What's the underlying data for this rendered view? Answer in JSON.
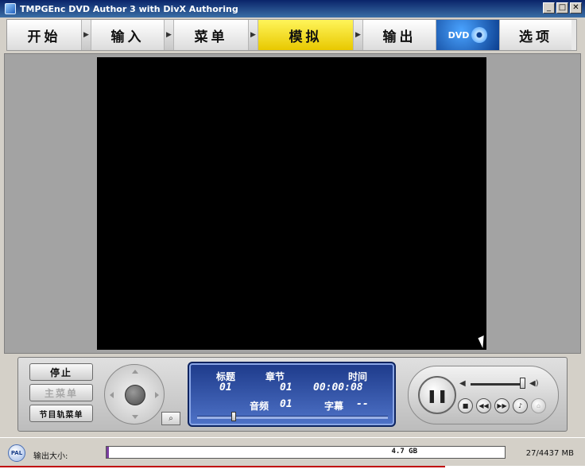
{
  "window": {
    "title": "TMPGEnc DVD Author 3 with DivX Authoring"
  },
  "tabs": [
    {
      "label": "开始"
    },
    {
      "label": "输入"
    },
    {
      "label": "菜单"
    },
    {
      "label": "模拟"
    },
    {
      "label": "输出"
    },
    {
      "label": "选项"
    }
  ],
  "dvd_logo": {
    "text": "DVD"
  },
  "player": {
    "stop_label": "停止",
    "main_menu_label": "主菜单",
    "title_menu_label": "节目轨菜单",
    "display": {
      "title_label": "标题",
      "title_value": "01",
      "chapter_label": "章节",
      "chapter_value": "01",
      "time_label": "时间",
      "time_value": "00:00:08",
      "audio_label": "音频",
      "audio_value": "01",
      "subtitle_label": "字幕",
      "subtitle_value": "--"
    },
    "seek_level": 0.18
  },
  "status": {
    "pal_label": "PAL",
    "output_size_label": "输出大小:",
    "capacity": "4.7 GB",
    "usage": "27/4437 MB",
    "usage_fraction": 0.006
  },
  "colors": {
    "active_tab": "#f5e000",
    "display_bg": "#2e4fa8"
  }
}
